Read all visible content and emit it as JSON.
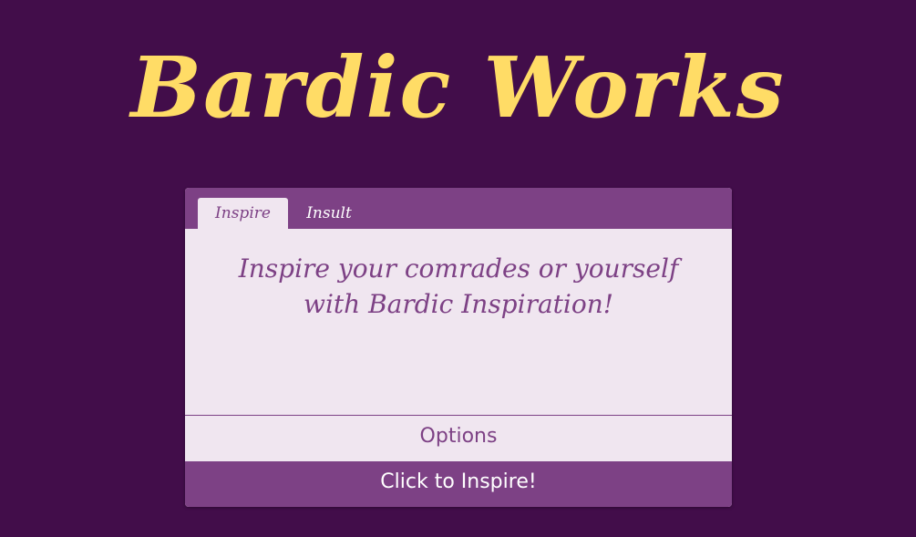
{
  "app": {
    "title": "Bardic Works"
  },
  "tabs": [
    {
      "label": "Inspire",
      "active": true
    },
    {
      "label": "Insult",
      "active": false
    }
  ],
  "panel": {
    "message": "Inspire your comrades or yourself with Bardic Inspiration!"
  },
  "options": {
    "label": "Options"
  },
  "action": {
    "label": "Click to Inspire!"
  },
  "colors": {
    "background": "#420d4a",
    "accent": "#7d4185",
    "title": "#ffdc66",
    "card": "#f0e6f0"
  }
}
